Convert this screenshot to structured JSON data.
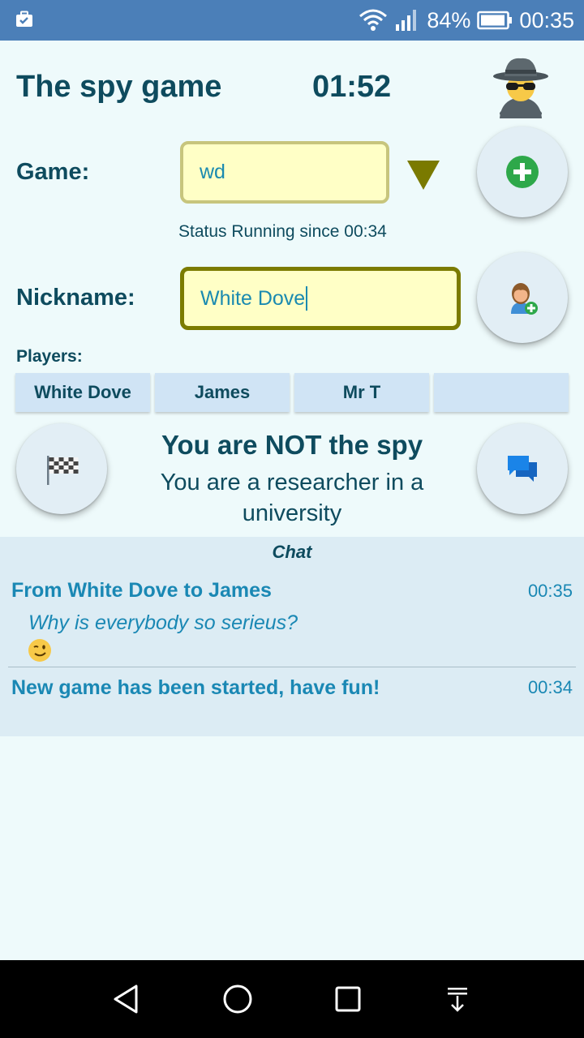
{
  "status_bar": {
    "battery": "84%",
    "time": "00:35"
  },
  "header": {
    "title": "The spy game",
    "timer": "01:52"
  },
  "game": {
    "label": "Game:",
    "value": "wd",
    "status": "Status Running since 00:34"
  },
  "nickname": {
    "label": "Nickname:",
    "value": "White Dove"
  },
  "players": {
    "label": "Players:",
    "items": [
      "White Dove",
      "James",
      "Mr T",
      ""
    ]
  },
  "role": {
    "title": "You are NOT the spy",
    "description": "You are a researcher in a university"
  },
  "chat": {
    "header": "Chat",
    "messages": [
      {
        "from": "From White Dove to James",
        "time": "00:35",
        "text": "Why is everybody so serieus?",
        "emoji": "winking-face"
      },
      {
        "from": "New game has been started, have fun!",
        "time": "00:34"
      }
    ]
  },
  "colors": {
    "primary_text": "#0e4b5e",
    "accent": "#1a88b4",
    "status_bar": "#4b7fb8",
    "input_bg": "#ffffc6",
    "add_green": "#2ea84a",
    "chat_blue": "#1a73e8"
  },
  "icons": [
    "spy-icon",
    "dropdown-arrow-icon",
    "add-game-icon",
    "add-person-icon",
    "checkered-flag-icon",
    "chat-bubbles-icon"
  ]
}
